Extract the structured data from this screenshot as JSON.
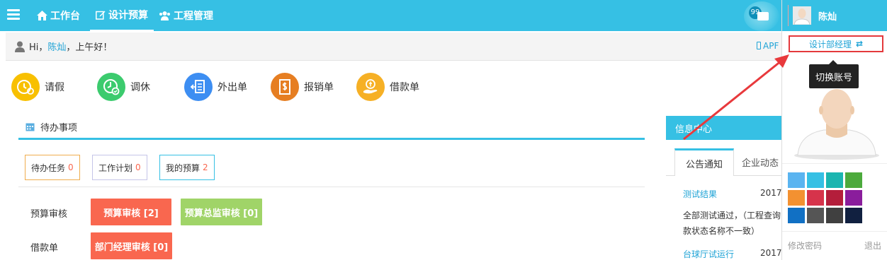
{
  "nav": {
    "workbench": "工作台",
    "design_budget": "设计预算",
    "project_mgmt": "工程管理"
  },
  "messages": {
    "count": "99"
  },
  "user": {
    "name": "陈灿",
    "role": "设计部经理",
    "switch_tooltip": "切换账号"
  },
  "greeting": {
    "prefix": "Hi，",
    "name": "陈灿",
    "suffix": "，上午好！"
  },
  "app_link": "APF",
  "quick_actions": [
    {
      "label": "请假",
      "color": "#f8c000"
    },
    {
      "label": "调休",
      "color": "#3ccb6e"
    },
    {
      "label": "外出单",
      "color": "#3d8ef2"
    },
    {
      "label": "报销单",
      "color": "#e67e22"
    },
    {
      "label": "借款单",
      "color": "#f6b025"
    }
  ],
  "todo": {
    "title": "待办事项",
    "tabs": [
      {
        "label": "待办任务",
        "count": "0"
      },
      {
        "label": "工作计划",
        "count": "0"
      },
      {
        "label": "我的预算",
        "count": "2"
      }
    ],
    "rows": [
      {
        "label": "预算审核",
        "actions": [
          {
            "label": "预算审核 [2]",
            "color": "#f9674f"
          },
          {
            "label": "预算总监审核 [0]",
            "color": "#a0d468"
          }
        ]
      },
      {
        "label": "借款单",
        "actions": [
          {
            "label": "部门经理审核 [0]",
            "color": "#f9674f"
          }
        ]
      }
    ]
  },
  "info": {
    "title": "信息中心",
    "tabs": [
      "公告通知",
      "企业动态"
    ],
    "items": [
      {
        "title": "测试结果",
        "date": "2017",
        "body": [
          "全部测试通过，（工程查询",
          "款状态名称不一致）"
        ]
      },
      {
        "title": "台球厅试运行",
        "date": "2017"
      }
    ]
  },
  "theme_colors": [
    "#5ab4f0",
    "#36c0e4",
    "#1bb5b0",
    "#4caa3c",
    "#f39131",
    "#d6334b",
    "#b41e3b",
    "#8a1d9c",
    "#1170c4",
    "#555555",
    "#404040",
    "#112040"
  ],
  "user_panel": {
    "change_password": "修改密码",
    "logout": "退出"
  }
}
